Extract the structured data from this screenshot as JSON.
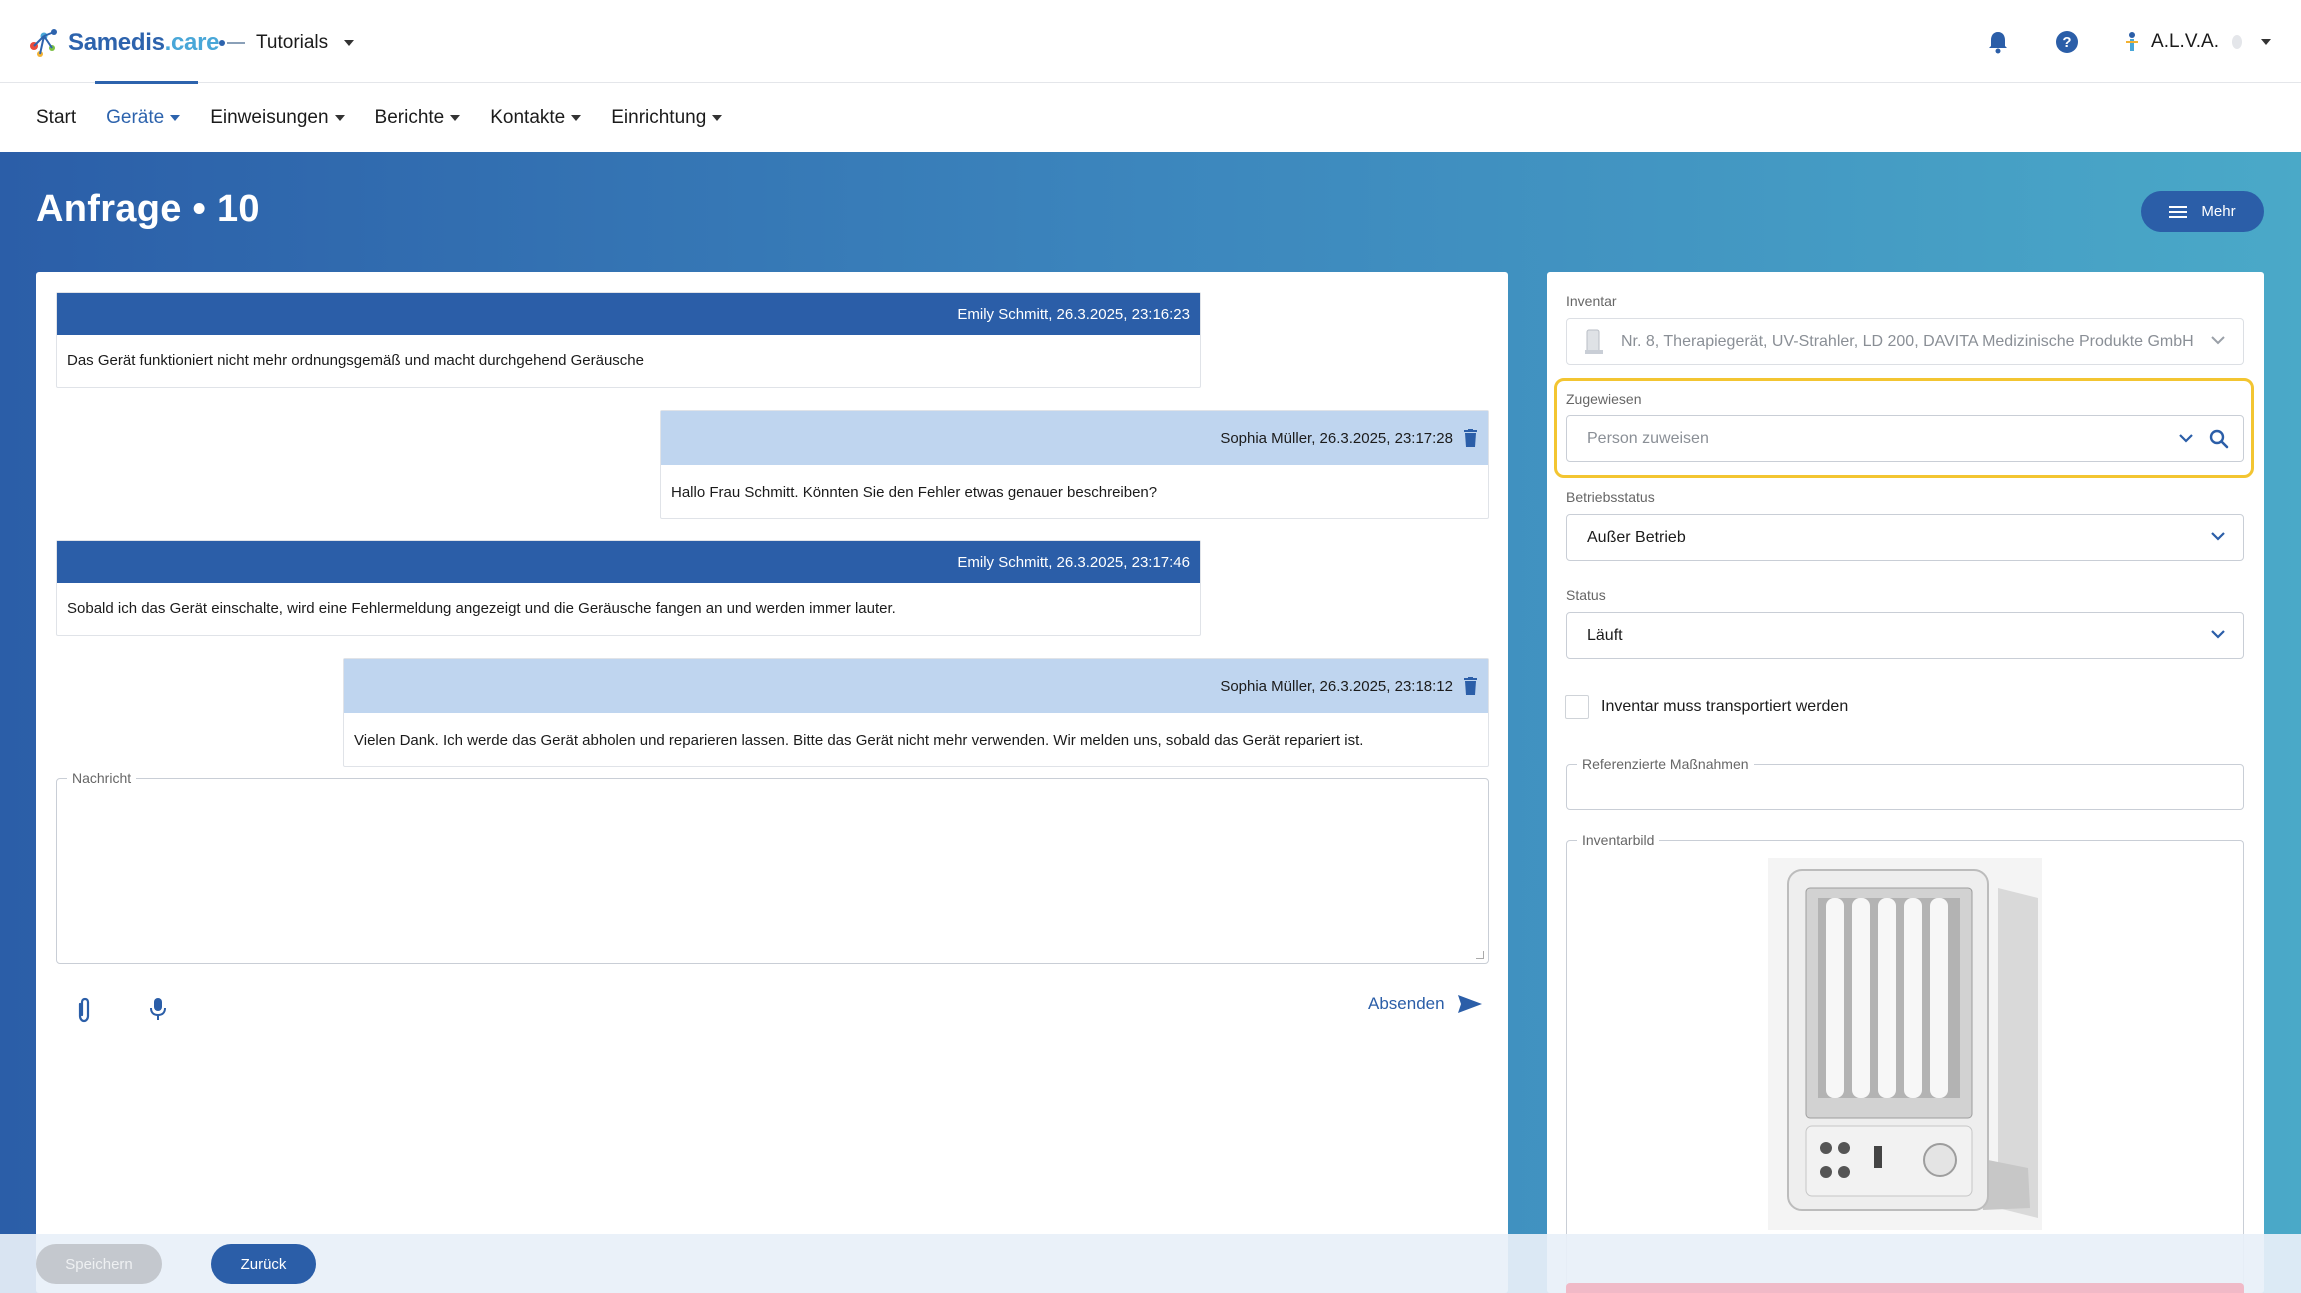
{
  "app": {
    "brand_main": "Samedis",
    "brand_suffix": ".care",
    "tenant": "Tutorials",
    "user": "A.L.V.A."
  },
  "nav": {
    "items": [
      {
        "label": "Start",
        "has_menu": false
      },
      {
        "label": "Geräte",
        "has_menu": true,
        "active": true
      },
      {
        "label": "Einweisungen",
        "has_menu": true
      },
      {
        "label": "Berichte",
        "has_menu": true
      },
      {
        "label": "Kontakte",
        "has_menu": true
      },
      {
        "label": "Einrichtung",
        "has_menu": true
      }
    ]
  },
  "page": {
    "title": "Anfrage • 10",
    "more_button": "Mehr"
  },
  "messages": [
    {
      "direction": "in",
      "author_time": "Emily Schmitt, 26.3.2025, 23:16:23",
      "text": "Das Gerät funktioniert nicht mehr ordnungsgemäß und macht durchgehend Geräusche"
    },
    {
      "direction": "out",
      "author_time": "Sophia Müller, 26.3.2025, 23:17:28",
      "text": "Hallo Frau Schmitt. Könnten Sie den Fehler etwas genauer beschreiben?"
    },
    {
      "direction": "in",
      "author_time": "Emily Schmitt, 26.3.2025, 23:17:46",
      "text": "Sobald ich das Gerät einschalte, wird eine Fehlermeldung angezeigt und die Geräusche fangen an und werden immer lauter."
    },
    {
      "direction": "out",
      "author_time": "Sophia Müller, 26.3.2025, 23:18:12",
      "text": "Vielen Dank. Ich werde das Gerät abholen und reparieren lassen. Bitte das Gerät nicht mehr verwenden. Wir melden uns, sobald das Gerät repariert ist."
    }
  ],
  "composer": {
    "label": "Nachricht",
    "value": "",
    "send_label": "Absenden"
  },
  "sidebar": {
    "inventar_label": "Inventar",
    "inventar_value": "Nr. 8, Therapiegerät, UV-Strahler, LD 200, DAVITA Medizinische Produkte GmbH",
    "assigned_label": "Zugewiesen",
    "assigned_placeholder": "Person zuweisen",
    "betriebsstatus_label": "Betriebsstatus",
    "betriebsstatus_value": "Außer Betrieb",
    "status_label": "Status",
    "status_value": "Läuft",
    "transport_label": "Inventar muss transportiert werden",
    "transport_checked": false,
    "referenced_label": "Referenzierte Maßnahmen",
    "image_label": "Inventarbild"
  },
  "footer": {
    "save_label": "Speichern",
    "back_label": "Zurück"
  },
  "colors": {
    "primary": "#2b5ea8",
    "accent": "#49a7d8",
    "highlight": "#f3c531",
    "outgoing_header": "#bfd5ef"
  },
  "icons": [
    "bell-icon",
    "help-icon",
    "trash-icon",
    "paperclip-icon",
    "microphone-icon",
    "send-icon",
    "search-icon",
    "chevron-down-icon",
    "menu-icon"
  ]
}
